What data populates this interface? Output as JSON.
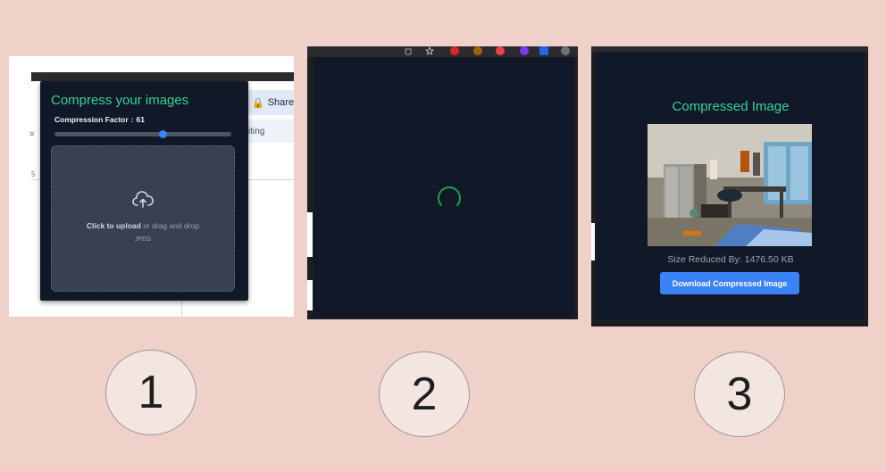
{
  "panel1": {
    "title": "Compress your images",
    "compression_label": "Compression Factor",
    "compression_value": 61,
    "slider_fraction": 0.61,
    "upload_bold": "Click to upload",
    "upload_rest": " or drag and drop",
    "file_type": "JPEG",
    "share_label": "Share",
    "editing_label": "iting",
    "ruler_mark": "5",
    "menu_glyph": "≡"
  },
  "panel2": {
    "spinner": "loading"
  },
  "panel3": {
    "title": "Compressed Image",
    "size_reduced": "Size Reduced By: 1476.50 KB",
    "download_label": "Download Compressed Image"
  },
  "steps": [
    "1",
    "2",
    "3"
  ],
  "colors": {
    "page_bg": "#f0d1c9",
    "popup_bg": "#111827",
    "accent_green": "#34d399",
    "button_blue": "#3b82f6",
    "spinner_green": "#16a34a"
  }
}
